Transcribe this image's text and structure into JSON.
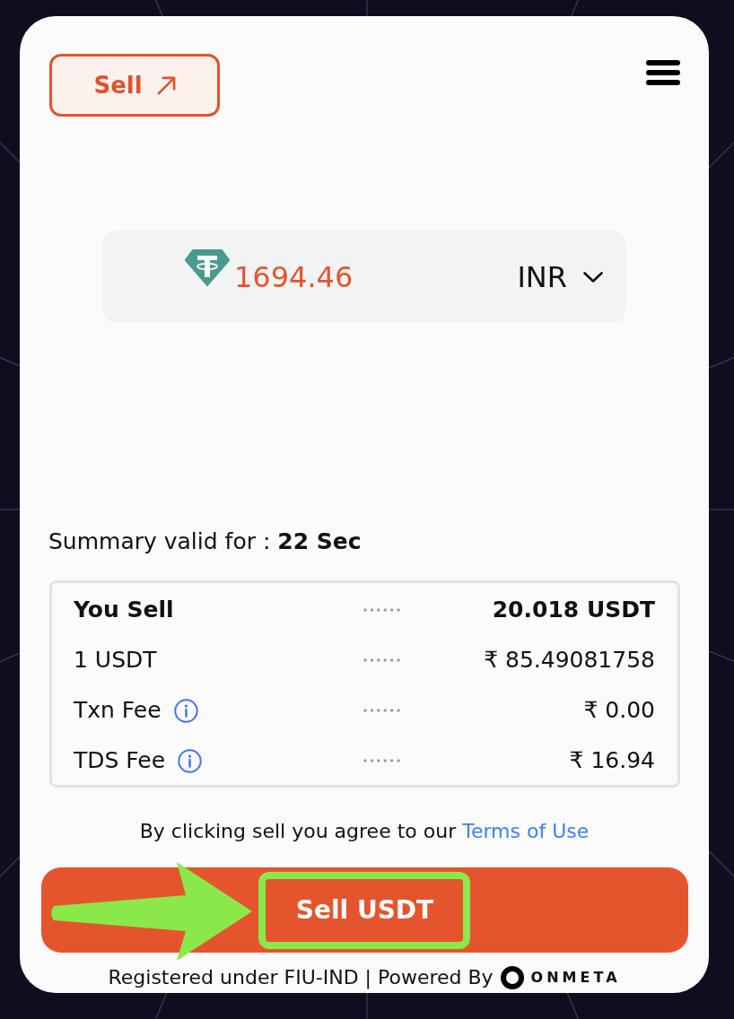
{
  "header": {
    "mode_button": {
      "label": "Sell"
    }
  },
  "amount_panel": {
    "amount": "1694.46",
    "currency": "INR"
  },
  "validity": "Summary valid for : **22 Sec**",
  "summary_rows": [
    {
      "label": "You Sell",
      "value": "20.018 USDT",
      "emphasis": true,
      "info": false
    },
    {
      "label": "1 USDT",
      "value": "₹ 85.49081758",
      "emphasis": false,
      "info": false
    },
    {
      "label": "Txn Fee",
      "value": "₹ 0.00",
      "emphasis": false,
      "info": true
    },
    {
      "label": "TDS Fee",
      "value": "₹ 16.94",
      "emphasis": false,
      "info": true
    }
  ],
  "terms": {
    "text": "By clicking sell you agree to our",
    "link": "Terms of Use"
  },
  "sell_button": {
    "label": "Sell USDT",
    "highlighted": true
  },
  "footer": {
    "text": "Registered under FIU-IND | Powered By",
    "brand": "ONMETA"
  }
}
